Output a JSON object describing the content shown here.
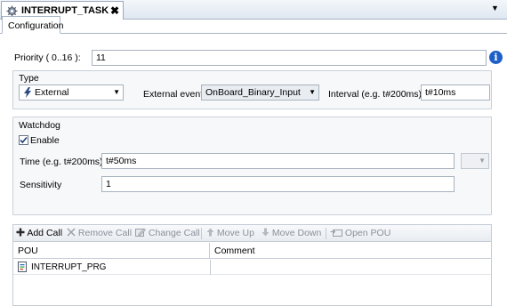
{
  "document_tab": {
    "title": "INTERRUPT_TASK",
    "close_glyph": "✖",
    "icon": "task-gear-icon"
  },
  "tab_dropdown_glyph": "▼",
  "subtab": {
    "label": "Configuration"
  },
  "priority": {
    "label": "Priority ( 0..16 ):",
    "value": "11",
    "info_glyph": "i"
  },
  "type_group": {
    "title": "Type",
    "type_value": "External",
    "type_icon": "lightning-icon",
    "external_event_label": "External event",
    "external_event_value": "OnBoard_Binary_Input",
    "interval_label": "Interval (e.g. t#200ms)",
    "interval_value": "t#10ms"
  },
  "watchdog_group": {
    "title": "Watchdog",
    "enable_label": "Enable",
    "enable_checked": true,
    "time_label": "Time (e.g. t#200ms)",
    "time_value": "t#50ms",
    "sensitivity_label": "Sensitivity",
    "sensitivity_value": "1"
  },
  "toolbar": {
    "add_call": "Add Call",
    "remove_call": "Remove Call",
    "change_call": "Change Call",
    "move_up": "Move Up",
    "move_down": "Move Down",
    "open_pou": "Open POU"
  },
  "grid": {
    "columns": [
      "POU",
      "Comment"
    ],
    "rows": [
      {
        "pou": "INTERRUPT_PRG",
        "comment": ""
      }
    ]
  },
  "combo_arrow_glyph": "▼"
}
